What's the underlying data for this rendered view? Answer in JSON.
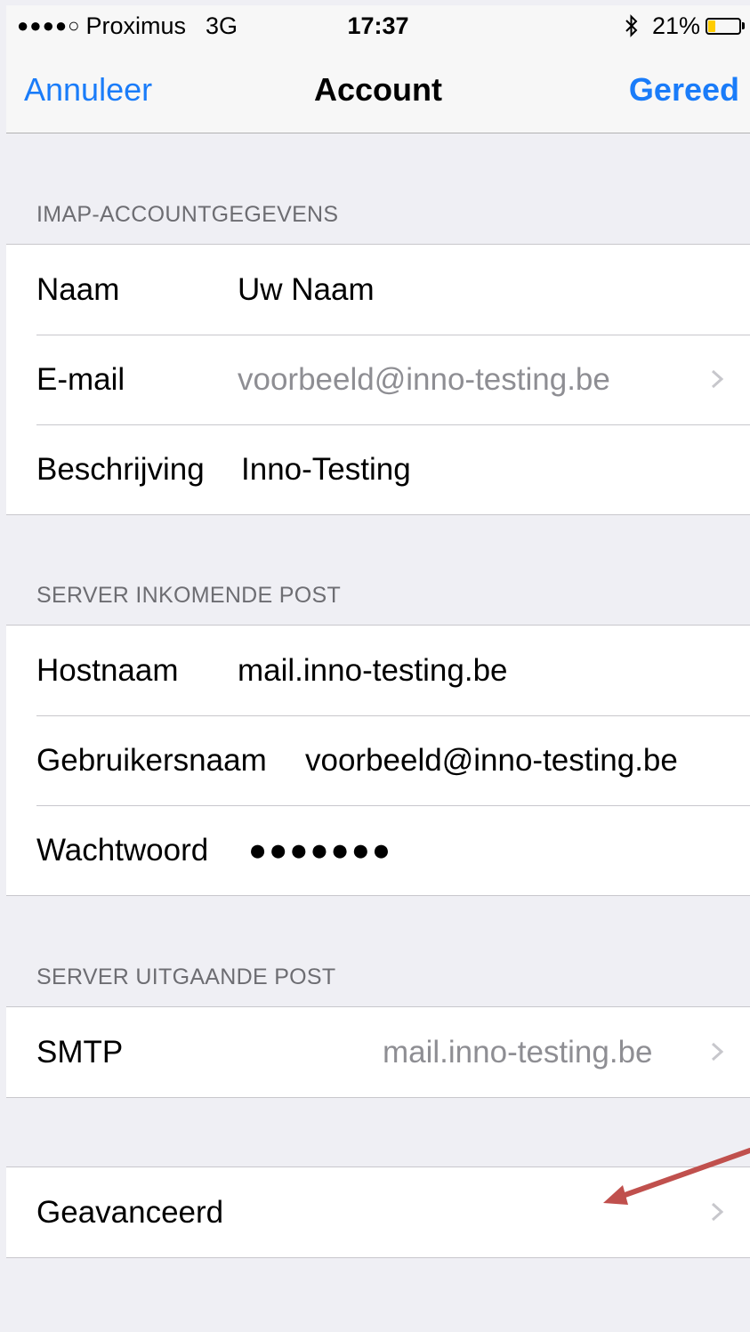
{
  "status_bar": {
    "signal_dots": "●●●●○",
    "carrier": "Proximus",
    "network": "3G",
    "time": "17:37",
    "battery": "21%",
    "battery_level": 0.21,
    "battery_color": "#ffcc00",
    "bluetooth_icon": "bluetooth-icon"
  },
  "nav": {
    "cancel_label": "Annuleer",
    "title": "Account",
    "done_label": "Gereed",
    "accent_color": "#1a7cf9"
  },
  "sections": {
    "imap": {
      "header": "IMAP-ACCOUNTGEGEVENS",
      "name_label": "Naam",
      "name_value": "Uw Naam",
      "email_label": "E-mail",
      "email_value": "voorbeeld@inno-testing.be",
      "description_label": "Beschrijving",
      "description_value": "Inno-Testing"
    },
    "incoming": {
      "header": "SERVER INKOMENDE POST",
      "host_label": "Hostnaam",
      "host_value": "mail.inno-testing.be",
      "user_label": "Gebruikersnaam",
      "user_value": "voorbeeld@inno-testing.be",
      "password_label": "Wachtwoord",
      "password_value": "●●●●●●●"
    },
    "outgoing": {
      "header": "SERVER UITGAANDE POST",
      "smtp_label": "SMTP",
      "smtp_value": "mail.inno-testing.be"
    },
    "advanced": {
      "label": "Geavanceerd"
    }
  },
  "annotation": {
    "arrow_color": "#c0504d",
    "icon": "arrow-annotation"
  }
}
